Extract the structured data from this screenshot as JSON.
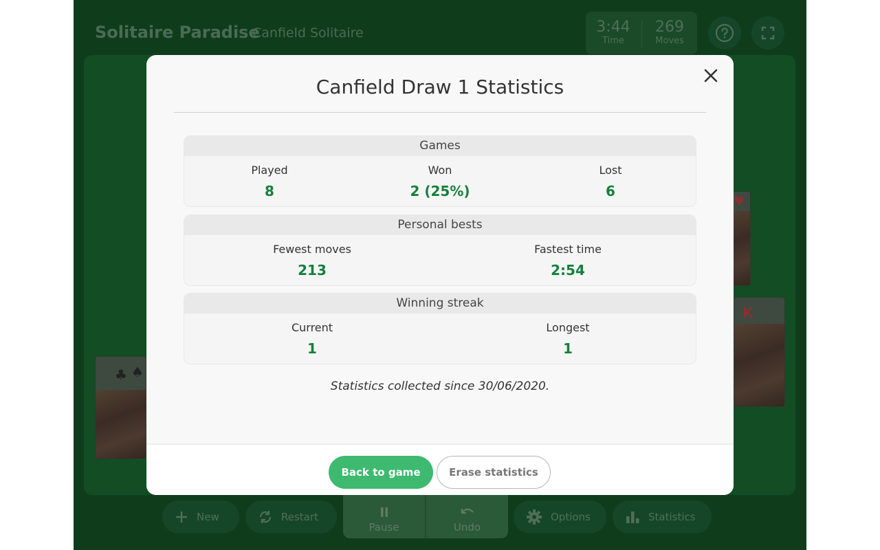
{
  "header": {
    "app_title": "Solitaire Paradise",
    "game_name": "Canfield Solitaire",
    "time": {
      "value": "3:44",
      "label": "Time"
    },
    "moves": {
      "value": "269",
      "label": "Moves"
    },
    "help_icon": "question-circle-icon",
    "fullscreen_icon": "fullscreen-icon"
  },
  "toolbar": {
    "new_label": "New",
    "restart_label": "Restart",
    "pause_label": "Pause",
    "undo_label": "Undo",
    "options_label": "Options",
    "statistics_label": "Statistics"
  },
  "cards": {
    "king_rank": "K",
    "heart_suit": "♥",
    "club_suit": "♣",
    "spade_suit": "♠"
  },
  "modal": {
    "title": "Canfield Draw 1 Statistics",
    "close_icon": "close-icon",
    "games": {
      "heading": "Games",
      "played_label": "Played",
      "played_value": "8",
      "won_label": "Won",
      "won_value": "2 (25%)",
      "lost_label": "Lost",
      "lost_value": "6"
    },
    "bests": {
      "heading": "Personal bests",
      "fewest_moves_label": "Fewest moves",
      "fewest_moves_value": "213",
      "fastest_time_label": "Fastest time",
      "fastest_time_value": "2:54"
    },
    "streak": {
      "heading": "Winning streak",
      "current_label": "Current",
      "current_value": "1",
      "longest_label": "Longest",
      "longest_value": "1"
    },
    "since_text": "Statistics collected since 30/06/2020.",
    "back_label": "Back to game",
    "erase_label": "Erase statistics"
  },
  "colors": {
    "background_green": "#0f3d1c",
    "accent_green": "#3dba6f",
    "value_green": "#14803c"
  }
}
